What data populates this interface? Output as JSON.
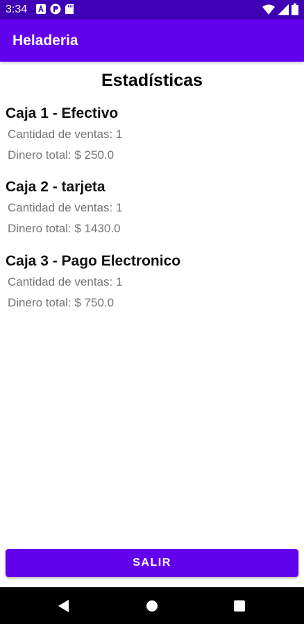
{
  "status_bar": {
    "time": "3:34",
    "icons_left": [
      "a-box-icon",
      "record-icon",
      "sd-card-icon"
    ],
    "icons_right": [
      "wifi-icon",
      "signal-icon",
      "battery-icon"
    ]
  },
  "app_bar": {
    "title": "Heladeria"
  },
  "main": {
    "title": "Estadísticas",
    "cajas": [
      {
        "title": "Caja 1 - Efectivo",
        "cantidad": "Cantidad de ventas: 1",
        "dinero": "Dinero total: $ 250.0"
      },
      {
        "title": "Caja 2 - tarjeta",
        "cantidad": "Cantidad de ventas: 1",
        "dinero": "Dinero total: $ 1430.0"
      },
      {
        "title": "Caja 3 - Pago Electronico",
        "cantidad": "Cantidad de ventas: 1",
        "dinero": "Dinero total: $ 750.0"
      }
    ]
  },
  "footer": {
    "salir_label": "SALIR"
  },
  "nav_bar": {
    "icons": [
      "back-icon",
      "home-icon",
      "recents-icon"
    ]
  },
  "colors": {
    "status_bar": "#3f00b5",
    "app_bar": "#6200ee",
    "button": "#6200ee",
    "secondary_text": "#757575"
  }
}
